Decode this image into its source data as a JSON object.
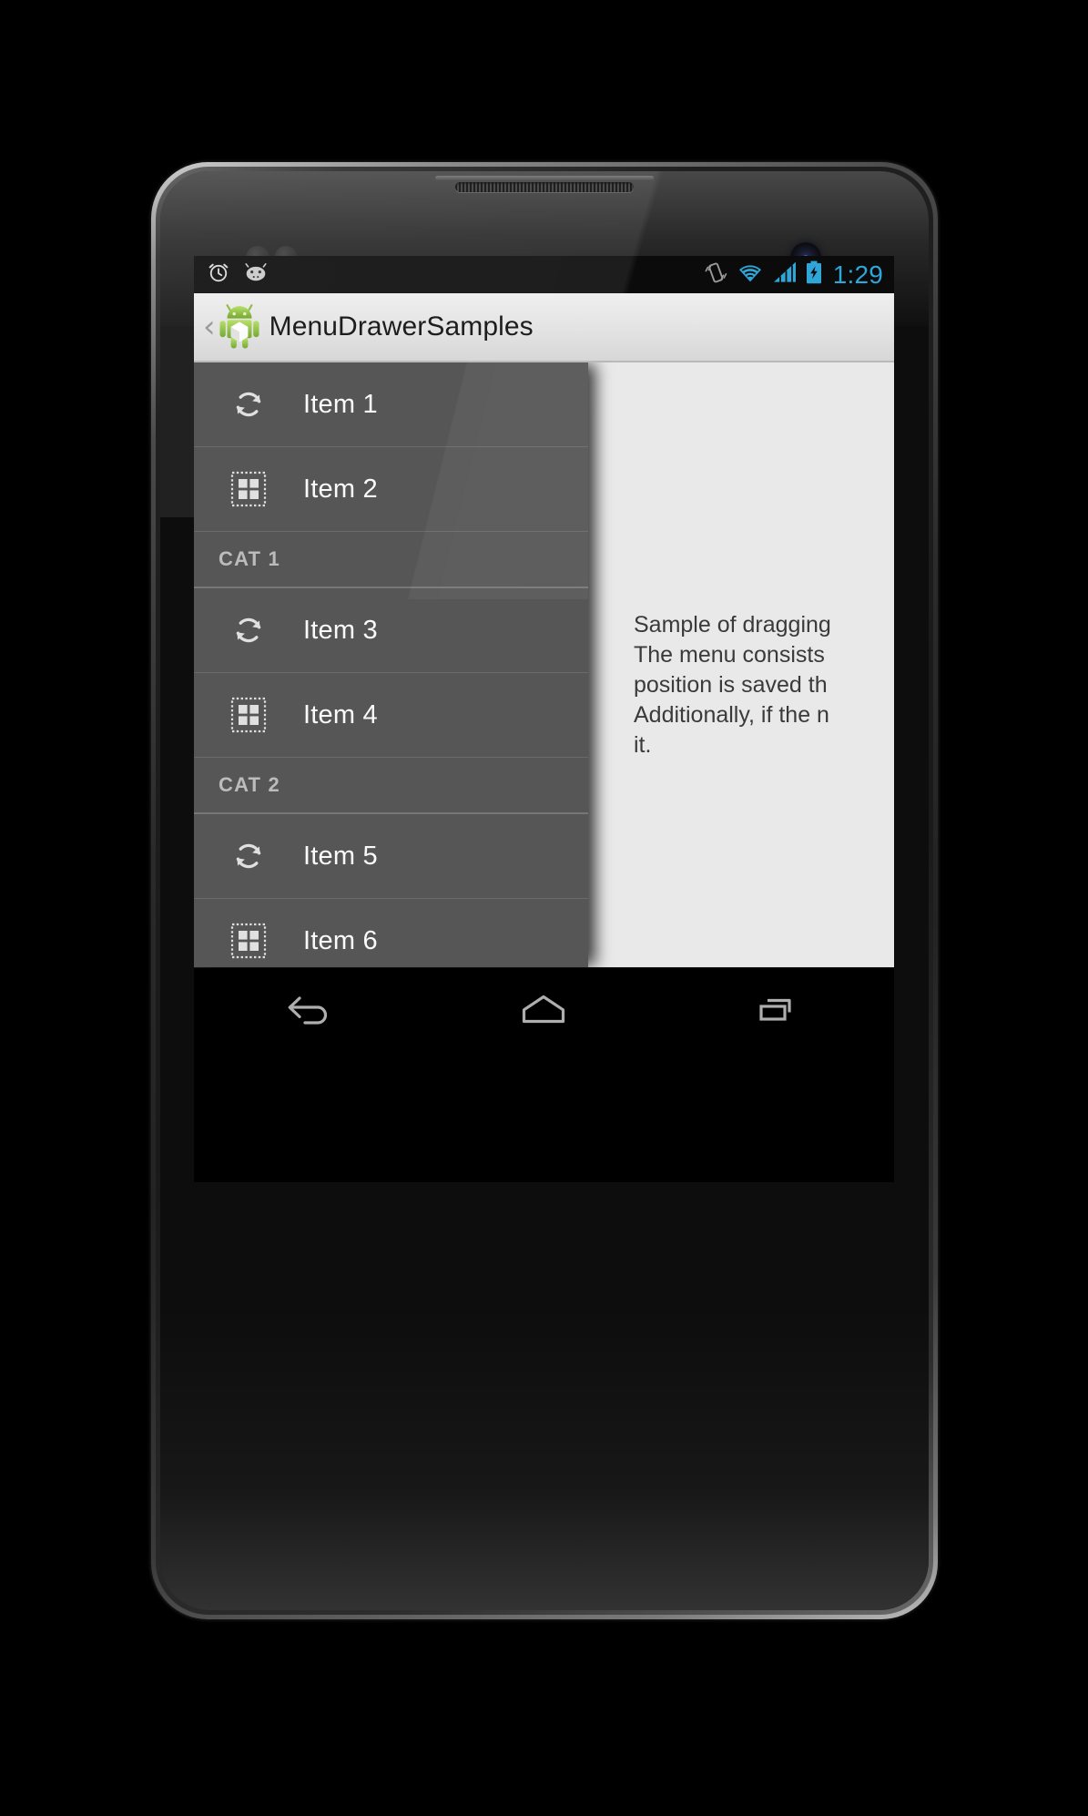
{
  "statusbar": {
    "left_icons": [
      {
        "name": "alarm-clock-icon",
        "label": "alarm"
      },
      {
        "name": "android-jellybean-icon",
        "label": "android"
      }
    ],
    "right_icons": [
      {
        "name": "vibrate-mode-icon",
        "label": "vibrate"
      },
      {
        "name": "wifi-icon",
        "label": "wifi"
      },
      {
        "name": "cellular-signal-icon",
        "label": "signal"
      },
      {
        "name": "battery-charging-icon",
        "label": "battery charging"
      }
    ],
    "clock": "1:29",
    "clock_color": "#2fa5d8",
    "background": "#0b0b0b"
  },
  "actionbar": {
    "up_caret": "‹",
    "app_icon": "android-robot-icon",
    "title": "MenuDrawerSamples",
    "background": "#e6e6e6",
    "title_color": "#1d1d1d"
  },
  "drawer": {
    "background": "#565656",
    "divider_color": "#6a6a6a",
    "items": [
      {
        "label": "Item 1",
        "icon": "refresh-icon",
        "type": "item"
      },
      {
        "label": "Item 2",
        "icon": "gallery-grid-icon",
        "type": "item"
      },
      {
        "label": "CAT 1",
        "icon": "",
        "type": "category"
      },
      {
        "label": "Item 3",
        "icon": "refresh-icon",
        "type": "item"
      },
      {
        "label": "Item 4",
        "icon": "gallery-grid-icon",
        "type": "item"
      },
      {
        "label": "CAT 2",
        "icon": "",
        "type": "category"
      },
      {
        "label": "Item 5",
        "icon": "refresh-icon",
        "type": "item"
      },
      {
        "label": "Item 6",
        "icon": "gallery-grid-icon",
        "type": "item"
      }
    ]
  },
  "content": {
    "background": "#e9e9e9",
    "text_color": "#3a3a3a",
    "paragraph": "Sample of dragging\nThe menu consists\nposition is saved th\nAdditionally, if the n\nit."
  },
  "navbar": {
    "background": "#000000",
    "buttons": [
      {
        "name": "back-button",
        "label": "Back"
      },
      {
        "name": "home-button",
        "label": "Home"
      },
      {
        "name": "recents-button",
        "label": "Recents"
      }
    ]
  }
}
